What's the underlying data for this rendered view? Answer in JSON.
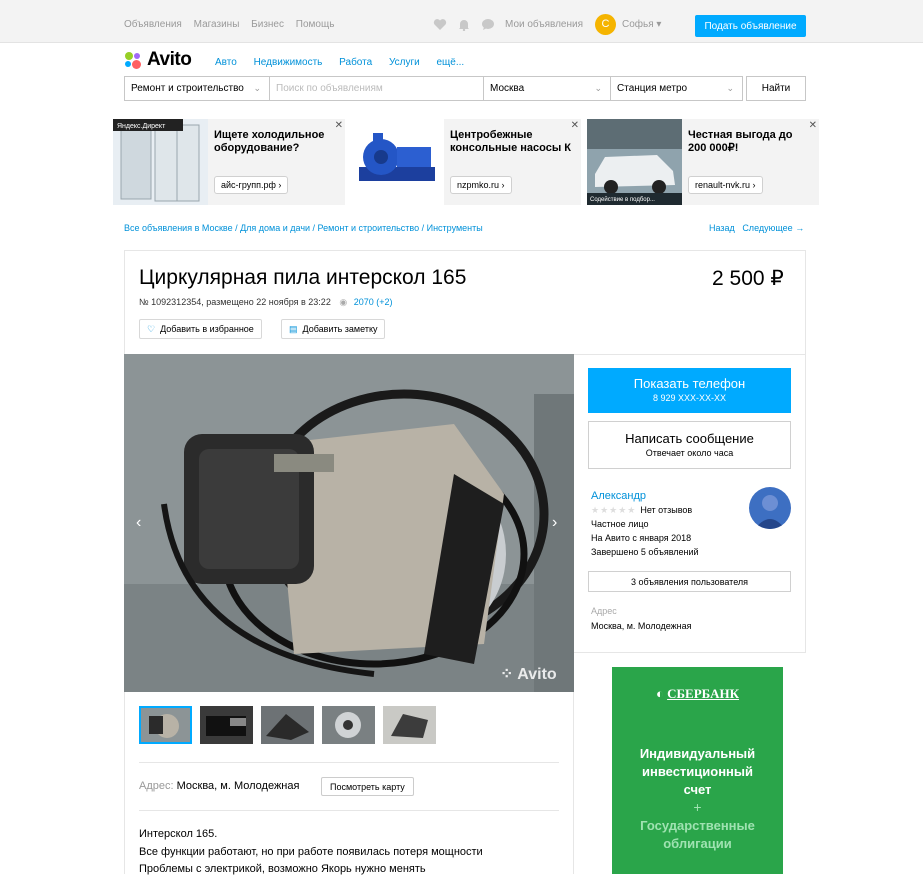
{
  "topbar": {
    "links": [
      "Объявления",
      "Магазины",
      "Бизнес",
      "Помощь"
    ],
    "my_ads": "Мои объявления",
    "user_initial": "С",
    "user_name": "Софья ▾",
    "post_button": "Подать объявление"
  },
  "logo": {
    "text": "Avito"
  },
  "categories": [
    "Авто",
    "Недвижимость",
    "Работа",
    "Услуги",
    "ещё..."
  ],
  "search": {
    "category": "Ремонт и строительство",
    "placeholder": "Поиск по объявлениям",
    "city": "Москва",
    "metro": "Станция метро",
    "button": "Найти"
  },
  "ads": [
    {
      "text": "Ищете холодильное оборудование?",
      "domain": "айс-групп.рф ›",
      "badge": "Яндекс.Директ"
    },
    {
      "text": "Центробежные консольные насосы К",
      "domain": "nzpmko.ru ›"
    },
    {
      "text": "Честная выгода до 200 000₽!",
      "domain": "renault-nvk.ru ›",
      "caption": "Содействие в подбор..."
    }
  ],
  "breadcrumbs": "Все объявления в Москве / Для дома и дачи / Ремонт и строительство / Инструменты",
  "nav": {
    "back": "Назад",
    "next": "Следующее →"
  },
  "listing": {
    "title": "Циркулярная пила интерскол 165",
    "price": "2 500 ₽",
    "meta": "№ 1092312354, размещено 22 ноября в 23:22",
    "views": "2070 (+2)",
    "fav_button": "Добавить в избранное",
    "note_button": "Добавить заметку",
    "watermark": "Avito",
    "address_label": "Адрес:",
    "address": "Москва, м. Молодежная",
    "map_button": "Посмотреть карту",
    "description": [
      "Интерскол 165.",
      "Все функции работают, но при работе появилась потеря мощности",
      "Проблемы с электрикой, возможно Якорь нужно менять"
    ]
  },
  "contact": {
    "phone_label": "Показать телефон",
    "phone": "8 929 XXX-XX-XX",
    "message_label": "Написать сообщение",
    "message_sub": "Отвечает около часа"
  },
  "seller": {
    "name": "Александр",
    "reviews": "Нет отзывов",
    "type": "Частное лицо",
    "since": "На Авито с января 2018",
    "completed": "Завершено 5 объявлений",
    "ads_button": "3 объявления пользователя",
    "address_label": "Адрес",
    "address": "Москва, м. Молодежная"
  },
  "banner": {
    "brand": "СБЕРБАНК",
    "line1": "Индивидуальный",
    "line2": "инвестиционный",
    "line3": "счет",
    "plus": "+",
    "line4": "Государственные",
    "line5": "облигации"
  },
  "colors": {
    "accent": "#00aaff",
    "link": "#0091d9",
    "bank": "#2aa54a"
  }
}
